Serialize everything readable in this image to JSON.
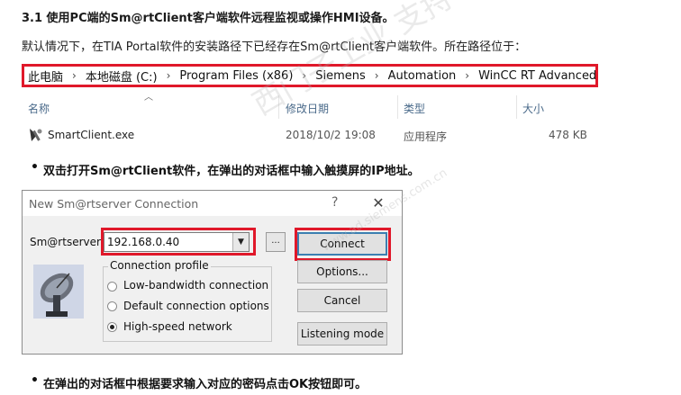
{
  "heading": "3.1 使用PC端的Sm@rtClient客户端软件远程监视或操作HMI设备。",
  "intro": "默认情况下，在TIA Portal软件的安装路径下已经存在Sm@rtClient客户端软件。所在路径位于：",
  "breadcrumb": [
    "此电脑",
    "本地磁盘 (C:)",
    "Program Files (x86)",
    "Siemens",
    "Automation",
    "WinCC RT Advanced"
  ],
  "columns": {
    "name": "名称",
    "modified": "修改日期",
    "type": "类型",
    "size": "大小"
  },
  "file": {
    "name": "SmartClient.exe",
    "modified": "2018/10/2 19:08",
    "type": "应用程序",
    "size": "478 KB"
  },
  "bullet1": "双击打开Sm@rtClient软件，在弹出的对话框中输入触摸屏的IP地址。",
  "dialog": {
    "title": "New Sm@rtserver Connection",
    "help": "?",
    "close": "✕",
    "server_label": "Sm@rtserver:",
    "server_value": "192.168.0.40",
    "browse": "...",
    "buttons": {
      "connect": "Connect",
      "options": "Options...",
      "cancel": "Cancel",
      "listening": "Listening mode"
    },
    "profile_label": "Connection profile",
    "profiles": [
      "Low-bandwidth connection",
      "Default connection options",
      "High-speed network"
    ],
    "selected_profile": 2
  },
  "bullet2": "在弹出的对话框中根据要求输入对应的密码点击OK按钮即可。",
  "watermark": "西门子工业 支持中心",
  "watermark_url": "www.ad.siemens.com.cn",
  "colors": {
    "highlight": "#e0182a",
    "column_header": "#4a6a8a",
    "default_button_border": "#3c7fb1"
  }
}
